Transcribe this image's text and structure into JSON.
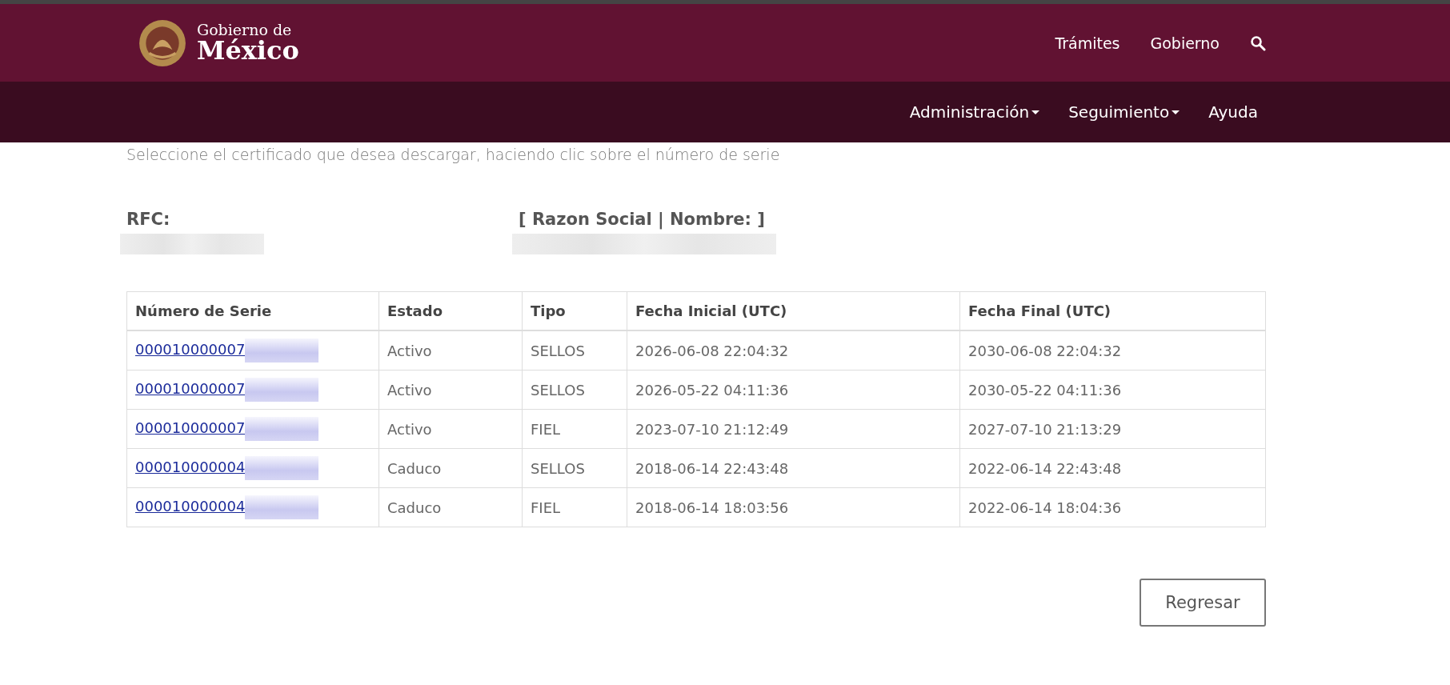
{
  "header": {
    "logo": {
      "line1": "Gobierno de",
      "line2": "México"
    },
    "links": [
      "Trámites",
      "Gobierno"
    ]
  },
  "nav": [
    {
      "label": "Administración",
      "dropdown": true
    },
    {
      "label": "Seguimiento",
      "dropdown": true
    },
    {
      "label": "Ayuda",
      "dropdown": false
    }
  ],
  "intro": "Seleccione el certificado que desea descargar, haciendo clic sobre el número de serie",
  "fields": [
    {
      "label": "RFC:"
    },
    {
      "label": "[ Razon Social | Nombre: ]"
    }
  ],
  "table": {
    "columns": [
      "Número de Serie",
      "Estado",
      "Tipo",
      "Fecha Inicial (UTC)",
      "Fecha Final (UTC)"
    ],
    "rows": [
      {
        "serial": "000010000007",
        "estado": "Activo",
        "tipo": "SELLOS",
        "inicio": "2026-06-08 22:04:32",
        "fin": "2030-06-08 22:04:32"
      },
      {
        "serial": "000010000007",
        "estado": "Activo",
        "tipo": "SELLOS",
        "inicio": "2026-05-22 04:11:36",
        "fin": "2030-05-22 04:11:36"
      },
      {
        "serial": "000010000007",
        "estado": "Activo",
        "tipo": "FIEL",
        "inicio": "2023-07-10 21:12:49",
        "fin": "2027-07-10 21:13:29"
      },
      {
        "serial": "000010000004",
        "estado": "Caduco",
        "tipo": "SELLOS",
        "inicio": "2018-06-14 22:43:48",
        "fin": "2022-06-14 22:43:48"
      },
      {
        "serial": "000010000004",
        "estado": "Caduco",
        "tipo": "FIEL",
        "inicio": "2018-06-14 18:03:56",
        "fin": "2022-06-14 18:04:36"
      }
    ]
  },
  "back_button": "Regresar"
}
